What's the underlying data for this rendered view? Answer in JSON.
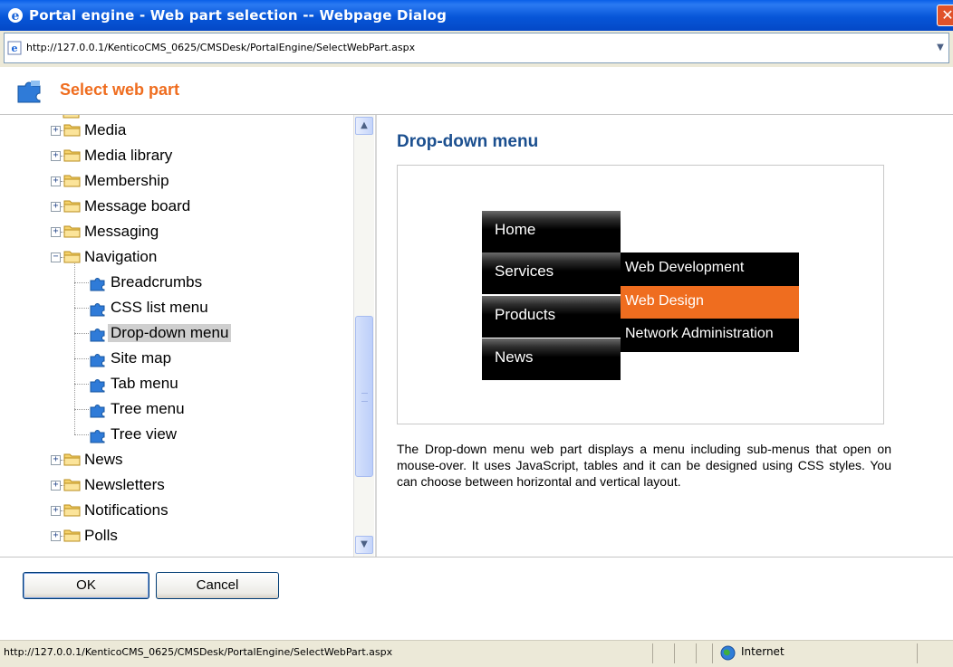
{
  "window": {
    "title": "Portal engine - Web part selection -- Webpage Dialog",
    "close_glyph": "✕"
  },
  "address_bar": {
    "url": "http://127.0.0.1/KenticoCMS_0625/CMSDesk/PortalEngine/SelectWebPart.aspx",
    "dropdown_glyph": "▼"
  },
  "header": {
    "icon": "puzzle-icon",
    "title": "Select web part"
  },
  "tree": {
    "items": [
      {
        "label": "Media",
        "type": "folder",
        "expanded": false
      },
      {
        "label": "Media library",
        "type": "folder",
        "expanded": false
      },
      {
        "label": "Membership",
        "type": "folder",
        "expanded": false
      },
      {
        "label": "Message board",
        "type": "folder",
        "expanded": false
      },
      {
        "label": "Messaging",
        "type": "folder",
        "expanded": false
      },
      {
        "label": "Navigation",
        "type": "folder",
        "expanded": true
      },
      {
        "label": "Breadcrumbs",
        "type": "webpart"
      },
      {
        "label": "CSS list menu",
        "type": "webpart"
      },
      {
        "label": "Drop-down menu",
        "type": "webpart",
        "selected": true
      },
      {
        "label": "Site map",
        "type": "webpart"
      },
      {
        "label": "Tab menu",
        "type": "webpart"
      },
      {
        "label": "Tree menu",
        "type": "webpart"
      },
      {
        "label": "Tree view",
        "type": "webpart"
      },
      {
        "label": "News",
        "type": "folder",
        "expanded": false
      },
      {
        "label": "Newsletters",
        "type": "folder",
        "expanded": false
      },
      {
        "label": "Notifications",
        "type": "folder",
        "expanded": false
      },
      {
        "label": "Polls",
        "type": "folder",
        "expanded": false
      }
    ],
    "expander_plus": "+",
    "expander_minus": "−"
  },
  "scrollbar": {
    "up_glyph": "▲",
    "down_glyph": "▼"
  },
  "detail": {
    "title": "Drop-down menu",
    "preview_menu": [
      "Home",
      "Services",
      "Products",
      "News"
    ],
    "preview_submenu": [
      "Web Development",
      "Web Design",
      "Network Administration"
    ],
    "highlight_color": "#ef6d1f",
    "description": "The Drop-down menu web part displays a menu including sub-menus that open on mouse-over. It uses JavaScript, tables and it can be designed using CSS styles. You can choose between horizontal and vertical layout."
  },
  "buttons": {
    "ok": "OK",
    "cancel": "Cancel"
  },
  "status_bar": {
    "url": "http://127.0.0.1/KenticoCMS_0625/CMSDesk/PortalEngine/SelectWebPart.aspx",
    "zone": "Internet",
    "zone_icon": "globe-icon"
  }
}
